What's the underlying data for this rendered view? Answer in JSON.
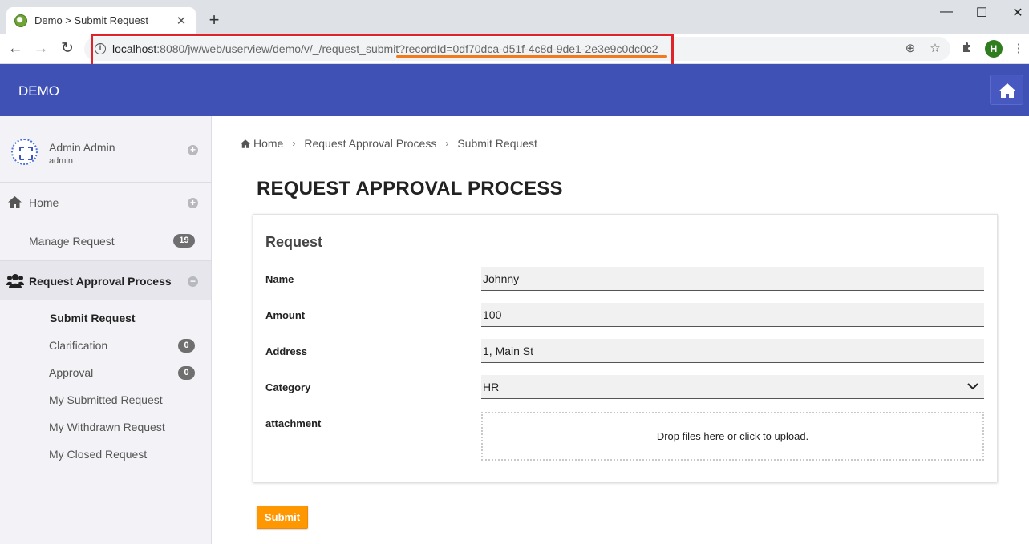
{
  "browser": {
    "tab_title": "Demo > Submit Request",
    "new_tab": "+",
    "url_host": "localhost",
    "url_rest": ":8080/jw/web/userview/demo/v/_/request_submit?recordId=0df70dca-d51f-4c8d-9de1-2e3e9c0dc0c2",
    "profile_initial": "H",
    "highlight_color": "#e0232b",
    "underline_color": "#f07a1d"
  },
  "app": {
    "brand": "DEMO",
    "header_color": "#3f51b5"
  },
  "sidebar": {
    "user_name": "Admin Admin",
    "user_login": "admin",
    "home_label": "Home",
    "manage_request_label": "Manage Request",
    "manage_request_count": "19",
    "category_label": "Request Approval Process",
    "items": [
      {
        "label": "Submit Request",
        "count": null
      },
      {
        "label": "Clarification",
        "count": "0"
      },
      {
        "label": "Approval",
        "count": "0"
      },
      {
        "label": "My Submitted Request",
        "count": null
      },
      {
        "label": "My Withdrawn Request",
        "count": null
      },
      {
        "label": "My Closed Request",
        "count": null
      }
    ]
  },
  "breadcrumb": {
    "home": "Home",
    "category": "Request Approval Process",
    "current": "Submit Request"
  },
  "page": {
    "title": "REQUEST APPROVAL PROCESS"
  },
  "form": {
    "section_title": "Request",
    "name_label": "Name",
    "name_value": "Johnny",
    "amount_label": "Amount",
    "amount_value": "100",
    "address_label": "Address",
    "address_value": "1, Main St",
    "category_label": "Category",
    "category_value": "HR",
    "attachment_label": "attachment",
    "dropzone_text": "Drop files here or click to upload.",
    "submit_label": "Submit",
    "submit_color": "#ff9800"
  }
}
